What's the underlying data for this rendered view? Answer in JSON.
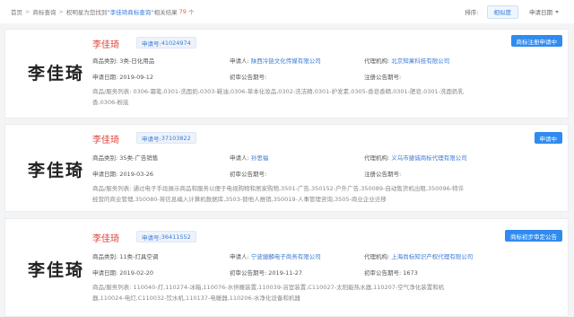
{
  "breadcrumb": {
    "home": "首页",
    "search": "商标查询",
    "prefix": "权明星为您找到",
    "query": "“李佳琦商标查询”",
    "middle": "相关结果",
    "count": "79",
    "suffix": "个"
  },
  "sort": {
    "label": "排序:",
    "relevance": "相似度",
    "date": "申请日期"
  },
  "labels": {
    "category": "商品类别:",
    "applicant": "申请人:",
    "agency": "代理机构:",
    "apply_date": "申请日期:",
    "prelim_no": "初审公告期号:",
    "reg_no": "注册公告期号:",
    "services": "商品/服务列表:",
    "appno_prefix": "申请号:"
  },
  "cards": [
    {
      "logo": "李佳琦",
      "name": "李佳琦",
      "appno": "41024974",
      "status": "商标注册申请中",
      "category": "3类-日化用品",
      "applicant": "陕西冷链文化传媒有限公司",
      "agency": "北京知果科技有限公司",
      "apply_date": "2019-09-12",
      "prelim_date": "",
      "prelim_no": "",
      "reg_no": "",
      "services": "0306-霜笔,0301-洗面奶,0303-鞋油,0306-草本化妆品,0302-洗洁精,0301-护发素,0305-香皂香精,0301-肥皂,0301-洗面奶乳香,0306-粉底"
    },
    {
      "logo": "李佳琦",
      "name": "李佳琦",
      "appno": "37103822",
      "status": "申请中",
      "category": "35类-广告销售",
      "applicant": "孙思福",
      "agency": "义乌市捷诚商标代理有限公司",
      "apply_date": "2019-03-26",
      "prelim_date": "",
      "prelim_no": "",
      "reg_no": "",
      "services": "通过电子手段展示商品和服务以便于电视购物和居家购物,3501-广告,350152-户外广告,350089-自动售货机出租,350096-特许经营的商业管理,350080-将信息编入计算机数据库,3503-替他人推销,350019-人事管理咨询,3505-商业企业迁移"
    },
    {
      "logo": "李佳琦",
      "name": "李佳琦",
      "appno": "36411552",
      "status": "商标初步审定公告",
      "category": "11类-灯具空调",
      "applicant": "宁波捷麟电子商务有限公司",
      "agency": "上海尚标知识产权代理有限公司",
      "apply_date": "2019-02-20",
      "prelim_date": "2019-11-27",
      "prelim_no": "1673",
      "reg_no": "",
      "services": "110040-灯,110274-冰箱,110076-水供暖装置,110039-浴室装置,C110027-太阳能热水器,110207-空气净化装置和机器,110024-电灯,C110032-饮水机,110137-电暖器,110206-水净化设备和机器"
    }
  ],
  "colors": {
    "accent": "#3a7bd5",
    "name": "#e0413a",
    "status": "#2f8bf0"
  }
}
